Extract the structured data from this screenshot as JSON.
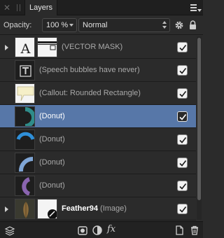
{
  "panel": {
    "tab_label": "Layers"
  },
  "controls": {
    "opacity_label": "Opacity:",
    "opacity_value": "100 %",
    "blend_mode": "Normal"
  },
  "layers": [
    {
      "name": "(VECTOR MASK)",
      "expandable": true,
      "visible": true,
      "thumb": "letter-a",
      "has_mask": true
    },
    {
      "name": "(Speech bubbles have never)",
      "expandable": false,
      "visible": true,
      "thumb": "text-tool"
    },
    {
      "name": "(Callout: Rounded Rectangle)",
      "expandable": false,
      "visible": true,
      "thumb": "callout"
    },
    {
      "name": "(Donut)",
      "expandable": false,
      "visible": true,
      "thumb": "donut-teal",
      "selected": true
    },
    {
      "name": "(Donut)",
      "expandable": false,
      "visible": true,
      "thumb": "donut-blue"
    },
    {
      "name": "(Donut)",
      "expandable": false,
      "visible": true,
      "thumb": "donut-lightblue"
    },
    {
      "name": "(Donut)",
      "expandable": false,
      "visible": true,
      "thumb": "donut-purple"
    },
    {
      "name": "Feather94",
      "type_suffix": "(Image)",
      "expandable": true,
      "visible": true,
      "thumb": "feather",
      "has_mask": true
    }
  ],
  "colors": {
    "panel_bg": "#2b2b2b",
    "selection": "#5777a8",
    "donut_teal": "#2f8c8a",
    "donut_blue": "#2f8fd8",
    "donut_lightblue": "#7fa6d6",
    "donut_purple": "#8a64b0",
    "callout_fill": "#f5efc8"
  },
  "bottom_icons": [
    "layers-stack-icon",
    "mask-icon",
    "adjustment-icon",
    "fx-icon",
    "new-layer-icon",
    "trash-icon"
  ],
  "fx_label": "fx"
}
